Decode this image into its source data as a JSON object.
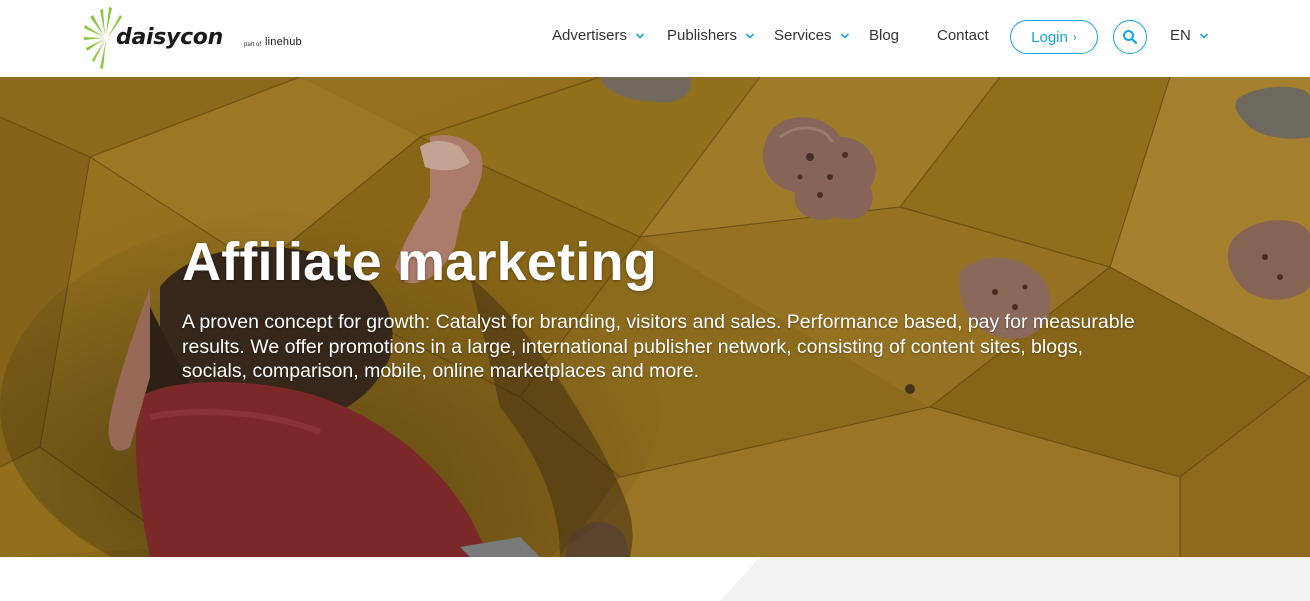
{
  "brand": {
    "name": "daisycon",
    "part_of": "part of",
    "parent": "linehub",
    "leaf_color": "#8cc63f"
  },
  "nav": {
    "items": [
      {
        "label": "Advertisers",
        "has_dropdown": true
      },
      {
        "label": "Publishers",
        "has_dropdown": true
      },
      {
        "label": "Services",
        "has_dropdown": true
      },
      {
        "label": "Blog",
        "has_dropdown": false
      },
      {
        "label": "Contact",
        "has_dropdown": false
      }
    ],
    "login_label": "Login",
    "login_icon": "chevron-right-icon",
    "search_icon": "search-icon",
    "language": "EN",
    "accent": "#16a6df"
  },
  "hero": {
    "title": "Affiliate marketing",
    "description": "A proven concept for growth: Catalyst for branding, visitors and sales. Performance based, pay for measurable results. We offer promotions in a large, international publisher network, consisting of content sites, blogs, socials, comparison, mobile, online marketplaces and more.",
    "background": "climbing-wall-photo"
  }
}
